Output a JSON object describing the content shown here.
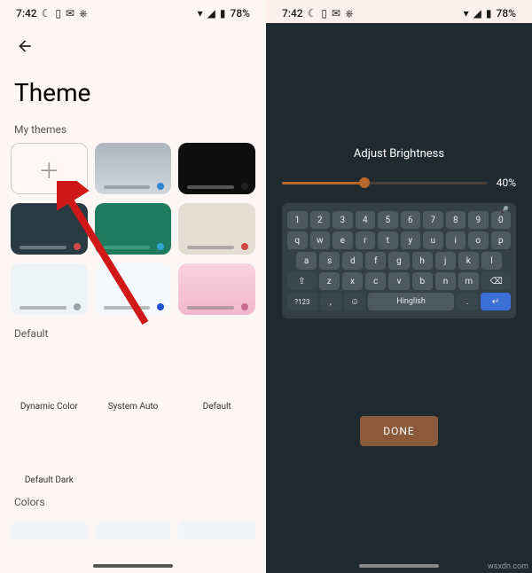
{
  "status": {
    "time": "7:42",
    "battery": "78%"
  },
  "left": {
    "title": "Theme",
    "sections": {
      "my_themes": "My themes",
      "default": "Default",
      "colors": "Colors"
    },
    "default_tiles": {
      "dynamic": "Dynamic Color",
      "system": "System Auto",
      "default": "Default",
      "dark": "Default Dark"
    }
  },
  "right": {
    "adjust_label": "Adjust Brightness",
    "brightness_value": "40%",
    "space_label": "Hinglish",
    "num_row": [
      "1",
      "2",
      "3",
      "4",
      "5",
      "6",
      "7",
      "8",
      "9",
      "0"
    ],
    "row1": [
      "q",
      "w",
      "e",
      "r",
      "t",
      "y",
      "u",
      "i",
      "o",
      "p"
    ],
    "row2": [
      "a",
      "s",
      "d",
      "f",
      "g",
      "h",
      "j",
      "k",
      "l"
    ],
    "row3_shift": "⇧",
    "row3": [
      "z",
      "x",
      "c",
      "v",
      "b",
      "n",
      "m"
    ],
    "row3_del": "⌫",
    "sym": "?123",
    "done": "DONE"
  },
  "watermark": "wsxdn.com"
}
